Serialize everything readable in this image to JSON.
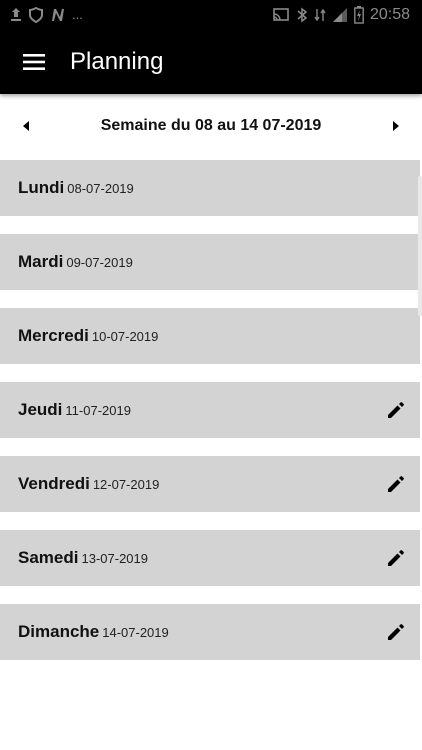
{
  "status_bar": {
    "time": "20:58",
    "left_icons": [
      "upload-icon",
      "shield-icon",
      "n-letter-icon",
      "more-dots-icon"
    ],
    "right_icons": [
      "cast-icon",
      "bluetooth-icon",
      "data-icon",
      "signal-icon",
      "battery-icon"
    ],
    "more_text": "..."
  },
  "app_bar": {
    "title": "Planning",
    "menu_icon": "hamburger-menu-icon"
  },
  "week_nav": {
    "label": "Semaine du 08 au 14 07-2019",
    "prev_icon": "triangle-left-icon",
    "next_icon": "triangle-right-icon"
  },
  "days": [
    {
      "name": "Lundi",
      "date": "08-07-2019",
      "editable": false
    },
    {
      "name": "Mardi",
      "date": "09-07-2019",
      "editable": false
    },
    {
      "name": "Mercredi",
      "date": "10-07-2019",
      "editable": false
    },
    {
      "name": "Jeudi",
      "date": "11-07-2019",
      "editable": true
    },
    {
      "name": "Vendredi",
      "date": "12-07-2019",
      "editable": true
    },
    {
      "name": "Samedi",
      "date": "13-07-2019",
      "editable": true
    },
    {
      "name": "Dimanche",
      "date": "14-07-2019",
      "editable": true
    }
  ],
  "colors": {
    "app_bar_bg": "#000000",
    "row_bg": "#d3d3d3",
    "text_primary": "#111111"
  }
}
